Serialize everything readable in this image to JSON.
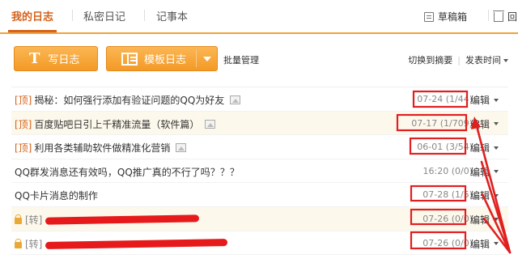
{
  "tabs": [
    {
      "label": "我的日志",
      "active": true
    },
    {
      "label": "私密日记",
      "active": false
    },
    {
      "label": "记事本",
      "active": false
    }
  ],
  "top_actions": {
    "drafts": "草稿箱",
    "recycle": "回"
  },
  "toolbar": {
    "write_icon": "T",
    "write_label": "写日志",
    "template_label": "模板日志",
    "batch_label": "批量管理",
    "switch_label": "切换到摘要",
    "sort_label": "发表时间"
  },
  "posts": [
    {
      "pin": "[顶]",
      "title": "揭秘：如何强行添加有验证问题的QQ为好友",
      "has_image": true,
      "meta": "07-24  (1/44)",
      "edit": "编辑",
      "locked": false
    },
    {
      "pin": "[顶]",
      "title": "百度贴吧日引上千精准流量（软件篇）",
      "has_image": true,
      "meta": "07-17  (1/709)",
      "edit": "编辑",
      "locked": false
    },
    {
      "pin": "[顶]",
      "title": "利用各类辅助软件做精准化营销",
      "has_image": true,
      "meta": "06-01  (3/54)",
      "edit": "编辑",
      "locked": false
    },
    {
      "pin": "",
      "title": "QQ群发消息还有效吗，QQ推广真的不行了吗？？？",
      "has_image": false,
      "meta": "16:20  (0/0)",
      "edit": "编辑",
      "locked": false
    },
    {
      "pin": "",
      "title": "QQ卡片消息的制作",
      "has_image": false,
      "meta": "07-28  (1/5)",
      "edit": "编辑",
      "locked": false
    },
    {
      "pin": "",
      "title": "[转]",
      "has_image": false,
      "meta": "07-26  (0/0)",
      "edit": "编辑",
      "locked": true
    },
    {
      "pin": "",
      "title": "[转]",
      "has_image": false,
      "meta": "07-26  (0/0)",
      "edit": "编辑",
      "locked": true
    }
  ],
  "colors": {
    "accent": "#f39a26",
    "active_tab": "#d4631b",
    "annotation": "#e02020"
  }
}
